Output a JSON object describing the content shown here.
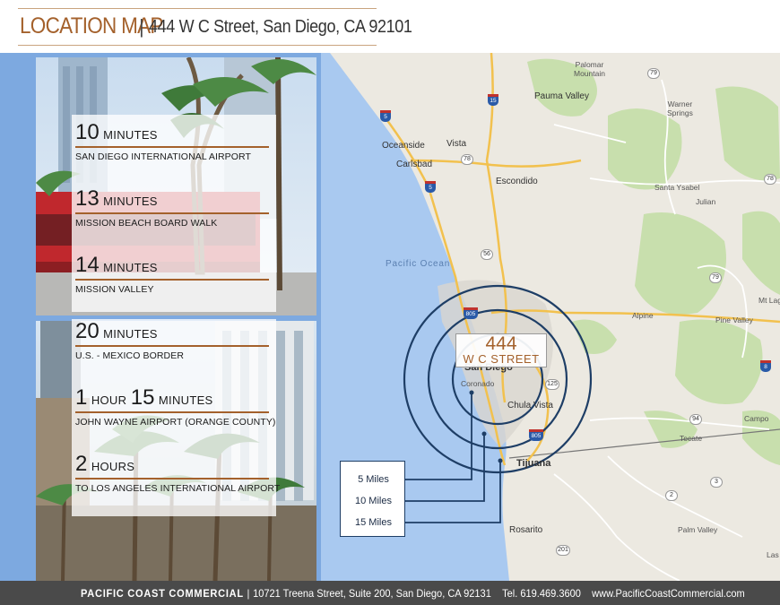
{
  "header": {
    "title": "LOCATION MAP",
    "separator": "|",
    "address": "444 W C Street, San Diego, CA 92101"
  },
  "drive_times": [
    {
      "amount": "10",
      "unit": "MINUTES",
      "amount2": "",
      "unit2": "",
      "destination": "SAN DIEGO INTERNATIONAL AIRPORT"
    },
    {
      "amount": "13",
      "unit": "MINUTES",
      "amount2": "",
      "unit2": "",
      "destination": "MISSION BEACH BOARD WALK"
    },
    {
      "amount": "14",
      "unit": "MINUTES",
      "amount2": "",
      "unit2": "",
      "destination": "MISSION VALLEY"
    },
    {
      "amount": "20",
      "unit": "MINUTES",
      "amount2": "",
      "unit2": "",
      "destination": "U.S. - MEXICO BORDER"
    },
    {
      "amount": "1",
      "unit": "HOUR",
      "amount2": "15",
      "unit2": "MINUTES",
      "destination": "JOHN WAYNE AIRPORT (ORANGE COUNTY)"
    },
    {
      "amount": "2",
      "unit": "HOURS",
      "amount2": "",
      "unit2": "",
      "destination": "TO LOS ANGELES INTERNATIONAL AIRPORT"
    }
  ],
  "map": {
    "marker_number": "444",
    "marker_street": "W C STREET",
    "radius_legend": [
      "5 Miles",
      "10 Miles",
      "15 Miles"
    ],
    "labels": {
      "palomar": "Palomar\nMountain",
      "pauma": "Pauma Valley",
      "warner": "Warner\nSprings",
      "oceanside": "Oceanside",
      "vista": "Vista",
      "carlsbad": "Carlsbad",
      "escondido": "Escondido",
      "santa_ysabel": "Santa Ysabel",
      "julian": "Julian",
      "pacific_ocean": "Pacific Ocean",
      "alpine": "Alpine",
      "pine_valley": "Pine Valley",
      "mt_laguna": "Mt Lag",
      "san_diego": "San Diego",
      "coronado": "Coronado",
      "chula_vista": "Chula Vista",
      "tecate": "Tecate",
      "campo": "Campo",
      "tijuana": "Tijuana",
      "rosarito": "Rosarito",
      "palm_valley": "Palm Valley",
      "las": "Las"
    },
    "shields": {
      "i15": "15",
      "i5a": "5",
      "i5b": "5",
      "i805a": "805",
      "i805b": "805",
      "i8": "8",
      "sr79a": "79",
      "sr79b": "79",
      "sr78a": "78",
      "sr78b": "78",
      "sr56": "56",
      "sr125": "125",
      "sr94": "94",
      "mx2": "2",
      "mx3": "3",
      "mx201": "201",
      "sr78c": "78"
    }
  },
  "footer": {
    "company": "PACIFIC COAST COMMERCIAL",
    "separator": "|",
    "address": "10721 Treena Street, Suite 200, San Diego, CA 92131",
    "phone": "Tel. 619.469.3600",
    "website": "www.PacificCoastCommercial.com"
  },
  "colors": {
    "accent": "#a4612c",
    "panel_blue": "#7da9e0",
    "footer_bg": "#4a4a4a",
    "ring": "#1e3e66"
  }
}
